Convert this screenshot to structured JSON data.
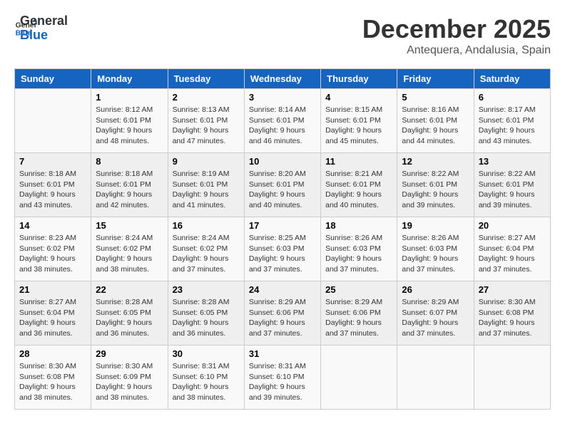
{
  "header": {
    "logo_general": "General",
    "logo_blue": "Blue",
    "month_title": "December 2025",
    "location": "Antequera, Andalusia, Spain"
  },
  "weekdays": [
    "Sunday",
    "Monday",
    "Tuesday",
    "Wednesday",
    "Thursday",
    "Friday",
    "Saturday"
  ],
  "weeks": [
    [
      {
        "day": "",
        "sunrise": "",
        "sunset": "",
        "daylight": ""
      },
      {
        "day": "1",
        "sunrise": "Sunrise: 8:12 AM",
        "sunset": "Sunset: 6:01 PM",
        "daylight": "Daylight: 9 hours and 48 minutes."
      },
      {
        "day": "2",
        "sunrise": "Sunrise: 8:13 AM",
        "sunset": "Sunset: 6:01 PM",
        "daylight": "Daylight: 9 hours and 47 minutes."
      },
      {
        "day": "3",
        "sunrise": "Sunrise: 8:14 AM",
        "sunset": "Sunset: 6:01 PM",
        "daylight": "Daylight: 9 hours and 46 minutes."
      },
      {
        "day": "4",
        "sunrise": "Sunrise: 8:15 AM",
        "sunset": "Sunset: 6:01 PM",
        "daylight": "Daylight: 9 hours and 45 minutes."
      },
      {
        "day": "5",
        "sunrise": "Sunrise: 8:16 AM",
        "sunset": "Sunset: 6:01 PM",
        "daylight": "Daylight: 9 hours and 44 minutes."
      },
      {
        "day": "6",
        "sunrise": "Sunrise: 8:17 AM",
        "sunset": "Sunset: 6:01 PM",
        "daylight": "Daylight: 9 hours and 43 minutes."
      }
    ],
    [
      {
        "day": "7",
        "sunrise": "Sunrise: 8:18 AM",
        "sunset": "Sunset: 6:01 PM",
        "daylight": "Daylight: 9 hours and 43 minutes."
      },
      {
        "day": "8",
        "sunrise": "Sunrise: 8:18 AM",
        "sunset": "Sunset: 6:01 PM",
        "daylight": "Daylight: 9 hours and 42 minutes."
      },
      {
        "day": "9",
        "sunrise": "Sunrise: 8:19 AM",
        "sunset": "Sunset: 6:01 PM",
        "daylight": "Daylight: 9 hours and 41 minutes."
      },
      {
        "day": "10",
        "sunrise": "Sunrise: 8:20 AM",
        "sunset": "Sunset: 6:01 PM",
        "daylight": "Daylight: 9 hours and 40 minutes."
      },
      {
        "day": "11",
        "sunrise": "Sunrise: 8:21 AM",
        "sunset": "Sunset: 6:01 PM",
        "daylight": "Daylight: 9 hours and 40 minutes."
      },
      {
        "day": "12",
        "sunrise": "Sunrise: 8:22 AM",
        "sunset": "Sunset: 6:01 PM",
        "daylight": "Daylight: 9 hours and 39 minutes."
      },
      {
        "day": "13",
        "sunrise": "Sunrise: 8:22 AM",
        "sunset": "Sunset: 6:01 PM",
        "daylight": "Daylight: 9 hours and 39 minutes."
      }
    ],
    [
      {
        "day": "14",
        "sunrise": "Sunrise: 8:23 AM",
        "sunset": "Sunset: 6:02 PM",
        "daylight": "Daylight: 9 hours and 38 minutes."
      },
      {
        "day": "15",
        "sunrise": "Sunrise: 8:24 AM",
        "sunset": "Sunset: 6:02 PM",
        "daylight": "Daylight: 9 hours and 38 minutes."
      },
      {
        "day": "16",
        "sunrise": "Sunrise: 8:24 AM",
        "sunset": "Sunset: 6:02 PM",
        "daylight": "Daylight: 9 hours and 37 minutes."
      },
      {
        "day": "17",
        "sunrise": "Sunrise: 8:25 AM",
        "sunset": "Sunset: 6:03 PM",
        "daylight": "Daylight: 9 hours and 37 minutes."
      },
      {
        "day": "18",
        "sunrise": "Sunrise: 8:26 AM",
        "sunset": "Sunset: 6:03 PM",
        "daylight": "Daylight: 9 hours and 37 minutes."
      },
      {
        "day": "19",
        "sunrise": "Sunrise: 8:26 AM",
        "sunset": "Sunset: 6:03 PM",
        "daylight": "Daylight: 9 hours and 37 minutes."
      },
      {
        "day": "20",
        "sunrise": "Sunrise: 8:27 AM",
        "sunset": "Sunset: 6:04 PM",
        "daylight": "Daylight: 9 hours and 37 minutes."
      }
    ],
    [
      {
        "day": "21",
        "sunrise": "Sunrise: 8:27 AM",
        "sunset": "Sunset: 6:04 PM",
        "daylight": "Daylight: 9 hours and 36 minutes."
      },
      {
        "day": "22",
        "sunrise": "Sunrise: 8:28 AM",
        "sunset": "Sunset: 6:05 PM",
        "daylight": "Daylight: 9 hours and 36 minutes."
      },
      {
        "day": "23",
        "sunrise": "Sunrise: 8:28 AM",
        "sunset": "Sunset: 6:05 PM",
        "daylight": "Daylight: 9 hours and 36 minutes."
      },
      {
        "day": "24",
        "sunrise": "Sunrise: 8:29 AM",
        "sunset": "Sunset: 6:06 PM",
        "daylight": "Daylight: 9 hours and 37 minutes."
      },
      {
        "day": "25",
        "sunrise": "Sunrise: 8:29 AM",
        "sunset": "Sunset: 6:06 PM",
        "daylight": "Daylight: 9 hours and 37 minutes."
      },
      {
        "day": "26",
        "sunrise": "Sunrise: 8:29 AM",
        "sunset": "Sunset: 6:07 PM",
        "daylight": "Daylight: 9 hours and 37 minutes."
      },
      {
        "day": "27",
        "sunrise": "Sunrise: 8:30 AM",
        "sunset": "Sunset: 6:08 PM",
        "daylight": "Daylight: 9 hours and 37 minutes."
      }
    ],
    [
      {
        "day": "28",
        "sunrise": "Sunrise: 8:30 AM",
        "sunset": "Sunset: 6:08 PM",
        "daylight": "Daylight: 9 hours and 38 minutes."
      },
      {
        "day": "29",
        "sunrise": "Sunrise: 8:30 AM",
        "sunset": "Sunset: 6:09 PM",
        "daylight": "Daylight: 9 hours and 38 minutes."
      },
      {
        "day": "30",
        "sunrise": "Sunrise: 8:31 AM",
        "sunset": "Sunset: 6:10 PM",
        "daylight": "Daylight: 9 hours and 38 minutes."
      },
      {
        "day": "31",
        "sunrise": "Sunrise: 8:31 AM",
        "sunset": "Sunset: 6:10 PM",
        "daylight": "Daylight: 9 hours and 39 minutes."
      },
      {
        "day": "",
        "sunrise": "",
        "sunset": "",
        "daylight": ""
      },
      {
        "day": "",
        "sunrise": "",
        "sunset": "",
        "daylight": ""
      },
      {
        "day": "",
        "sunrise": "",
        "sunset": "",
        "daylight": ""
      }
    ]
  ]
}
